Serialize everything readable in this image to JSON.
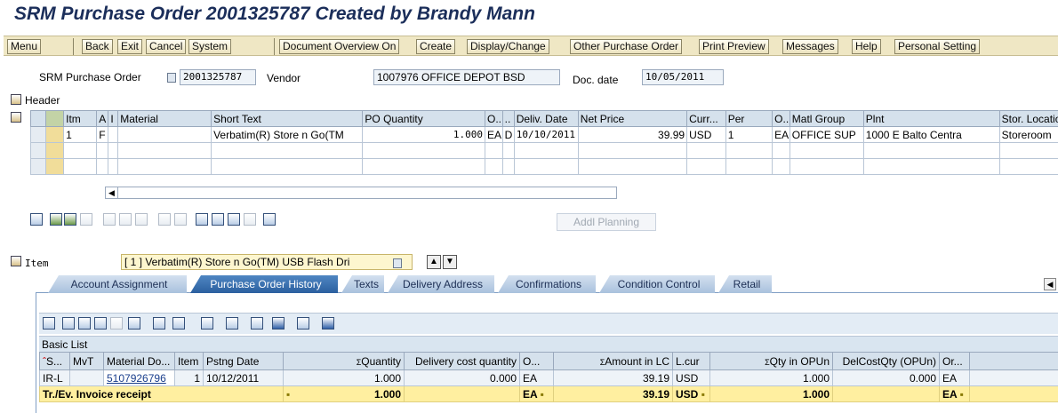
{
  "title": "SRM Purchase Order 2001325787 Created by Brandy Mann",
  "toolbar": {
    "buttons": [
      "Menu",
      "Back",
      "Exit",
      "Cancel",
      "System",
      "Document Overview On",
      "Create",
      "Display/Change",
      "Other Purchase Order",
      "Print Preview",
      "Messages",
      "Help",
      "Personal Setting"
    ]
  },
  "header_fields": {
    "type_label": "SRM Purchase Order",
    "po_number": "2001325787",
    "vendor_label": "Vendor",
    "vendor_value": "1007976 OFFICE DEPOT BSD",
    "doc_date_label": "Doc. date",
    "doc_date_value": "10/05/2011"
  },
  "header_label": "Header",
  "items_table": {
    "columns": [
      "Itm",
      "A",
      "I",
      "Material",
      "Short Text",
      "PO Quantity",
      "O...",
      "..",
      "Deliv. Date",
      "Net Price",
      "Curr...",
      "Per",
      "O...",
      "Matl Group",
      "Plnt",
      "Stor. Location"
    ],
    "rows": [
      [
        "1",
        "F",
        "",
        "",
        "Verbatim(R) Store n Go(TM",
        "1.000",
        "EA",
        "D",
        "10/10/2011",
        "39.99",
        "USD",
        "1",
        "EA",
        "OFFICE SUP",
        "1000 E Balto Centra",
        "Storeroom"
      ]
    ]
  },
  "addl_planning_label": "Addl Planning",
  "item_section": {
    "label": "Item",
    "selected": "[ 1 ] Verbatim(R) Store n Go(TM) USB Flash Dri"
  },
  "tabs": [
    "Account Assignment",
    "Purchase Order History",
    "Texts",
    "Delivery Address",
    "Confirmations",
    "Condition Control",
    "Retail"
  ],
  "active_tab": "Purchase Order History",
  "basic_list_label": "Basic List",
  "history_table": {
    "columns": [
      "S...",
      "MvT",
      "Material Do...",
      "Item",
      "Pstng Date",
      "Quantity",
      "Delivery cost quantity",
      "O...",
      "Amount in LC",
      "L.cur",
      "Qty in OPUn",
      "DelCostQty (OPUn)",
      "Or..."
    ],
    "row": {
      "s": "IR-L",
      "mvt": "",
      "material_doc": "5107926796",
      "item": "1",
      "pstng_date": "10/12/2011",
      "quantity": "1.000",
      "del_cost_qty": "0.000",
      "o": "EA",
      "amount": "39.19",
      "lcur": "USD",
      "qty_opun": "1.000",
      "delcost_opun": "0.000",
      "or": "EA"
    },
    "total": {
      "label": "Tr./Ev. Invoice receipt",
      "quantity": "1.000",
      "o": "EA",
      "amount": "39.19",
      "lcur": "USD",
      "qty_opun": "1.000",
      "or": "EA"
    }
  }
}
